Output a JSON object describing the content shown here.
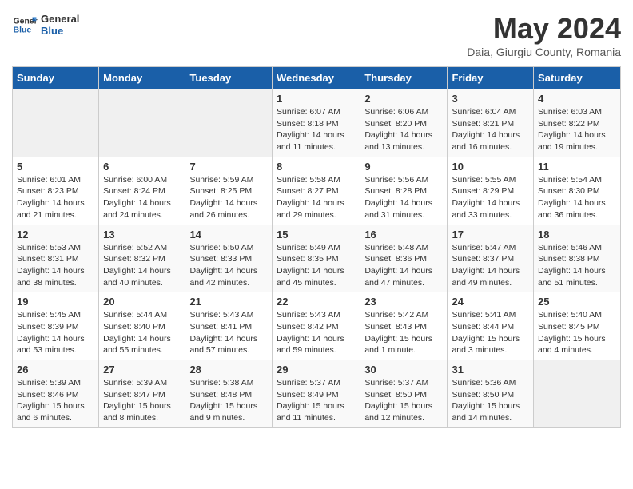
{
  "logo": {
    "text_general": "General",
    "text_blue": "Blue"
  },
  "title": "May 2024",
  "subtitle": "Daia, Giurgiu County, Romania",
  "days_of_week": [
    "Sunday",
    "Monday",
    "Tuesday",
    "Wednesday",
    "Thursday",
    "Friday",
    "Saturday"
  ],
  "weeks": [
    [
      {
        "day": "",
        "info": ""
      },
      {
        "day": "",
        "info": ""
      },
      {
        "day": "",
        "info": ""
      },
      {
        "day": "1",
        "info": "Sunrise: 6:07 AM\nSunset: 8:18 PM\nDaylight: 14 hours\nand 11 minutes."
      },
      {
        "day": "2",
        "info": "Sunrise: 6:06 AM\nSunset: 8:20 PM\nDaylight: 14 hours\nand 13 minutes."
      },
      {
        "day": "3",
        "info": "Sunrise: 6:04 AM\nSunset: 8:21 PM\nDaylight: 14 hours\nand 16 minutes."
      },
      {
        "day": "4",
        "info": "Sunrise: 6:03 AM\nSunset: 8:22 PM\nDaylight: 14 hours\nand 19 minutes."
      }
    ],
    [
      {
        "day": "5",
        "info": "Sunrise: 6:01 AM\nSunset: 8:23 PM\nDaylight: 14 hours\nand 21 minutes."
      },
      {
        "day": "6",
        "info": "Sunrise: 6:00 AM\nSunset: 8:24 PM\nDaylight: 14 hours\nand 24 minutes."
      },
      {
        "day": "7",
        "info": "Sunrise: 5:59 AM\nSunset: 8:25 PM\nDaylight: 14 hours\nand 26 minutes."
      },
      {
        "day": "8",
        "info": "Sunrise: 5:58 AM\nSunset: 8:27 PM\nDaylight: 14 hours\nand 29 minutes."
      },
      {
        "day": "9",
        "info": "Sunrise: 5:56 AM\nSunset: 8:28 PM\nDaylight: 14 hours\nand 31 minutes."
      },
      {
        "day": "10",
        "info": "Sunrise: 5:55 AM\nSunset: 8:29 PM\nDaylight: 14 hours\nand 33 minutes."
      },
      {
        "day": "11",
        "info": "Sunrise: 5:54 AM\nSunset: 8:30 PM\nDaylight: 14 hours\nand 36 minutes."
      }
    ],
    [
      {
        "day": "12",
        "info": "Sunrise: 5:53 AM\nSunset: 8:31 PM\nDaylight: 14 hours\nand 38 minutes."
      },
      {
        "day": "13",
        "info": "Sunrise: 5:52 AM\nSunset: 8:32 PM\nDaylight: 14 hours\nand 40 minutes."
      },
      {
        "day": "14",
        "info": "Sunrise: 5:50 AM\nSunset: 8:33 PM\nDaylight: 14 hours\nand 42 minutes."
      },
      {
        "day": "15",
        "info": "Sunrise: 5:49 AM\nSunset: 8:35 PM\nDaylight: 14 hours\nand 45 minutes."
      },
      {
        "day": "16",
        "info": "Sunrise: 5:48 AM\nSunset: 8:36 PM\nDaylight: 14 hours\nand 47 minutes."
      },
      {
        "day": "17",
        "info": "Sunrise: 5:47 AM\nSunset: 8:37 PM\nDaylight: 14 hours\nand 49 minutes."
      },
      {
        "day": "18",
        "info": "Sunrise: 5:46 AM\nSunset: 8:38 PM\nDaylight: 14 hours\nand 51 minutes."
      }
    ],
    [
      {
        "day": "19",
        "info": "Sunrise: 5:45 AM\nSunset: 8:39 PM\nDaylight: 14 hours\nand 53 minutes."
      },
      {
        "day": "20",
        "info": "Sunrise: 5:44 AM\nSunset: 8:40 PM\nDaylight: 14 hours\nand 55 minutes."
      },
      {
        "day": "21",
        "info": "Sunrise: 5:43 AM\nSunset: 8:41 PM\nDaylight: 14 hours\nand 57 minutes."
      },
      {
        "day": "22",
        "info": "Sunrise: 5:43 AM\nSunset: 8:42 PM\nDaylight: 14 hours\nand 59 minutes."
      },
      {
        "day": "23",
        "info": "Sunrise: 5:42 AM\nSunset: 8:43 PM\nDaylight: 15 hours\nand 1 minute."
      },
      {
        "day": "24",
        "info": "Sunrise: 5:41 AM\nSunset: 8:44 PM\nDaylight: 15 hours\nand 3 minutes."
      },
      {
        "day": "25",
        "info": "Sunrise: 5:40 AM\nSunset: 8:45 PM\nDaylight: 15 hours\nand 4 minutes."
      }
    ],
    [
      {
        "day": "26",
        "info": "Sunrise: 5:39 AM\nSunset: 8:46 PM\nDaylight: 15 hours\nand 6 minutes."
      },
      {
        "day": "27",
        "info": "Sunrise: 5:39 AM\nSunset: 8:47 PM\nDaylight: 15 hours\nand 8 minutes."
      },
      {
        "day": "28",
        "info": "Sunrise: 5:38 AM\nSunset: 8:48 PM\nDaylight: 15 hours\nand 9 minutes."
      },
      {
        "day": "29",
        "info": "Sunrise: 5:37 AM\nSunset: 8:49 PM\nDaylight: 15 hours\nand 11 minutes."
      },
      {
        "day": "30",
        "info": "Sunrise: 5:37 AM\nSunset: 8:50 PM\nDaylight: 15 hours\nand 12 minutes."
      },
      {
        "day": "31",
        "info": "Sunrise: 5:36 AM\nSunset: 8:50 PM\nDaylight: 15 hours\nand 14 minutes."
      },
      {
        "day": "",
        "info": ""
      }
    ]
  ]
}
